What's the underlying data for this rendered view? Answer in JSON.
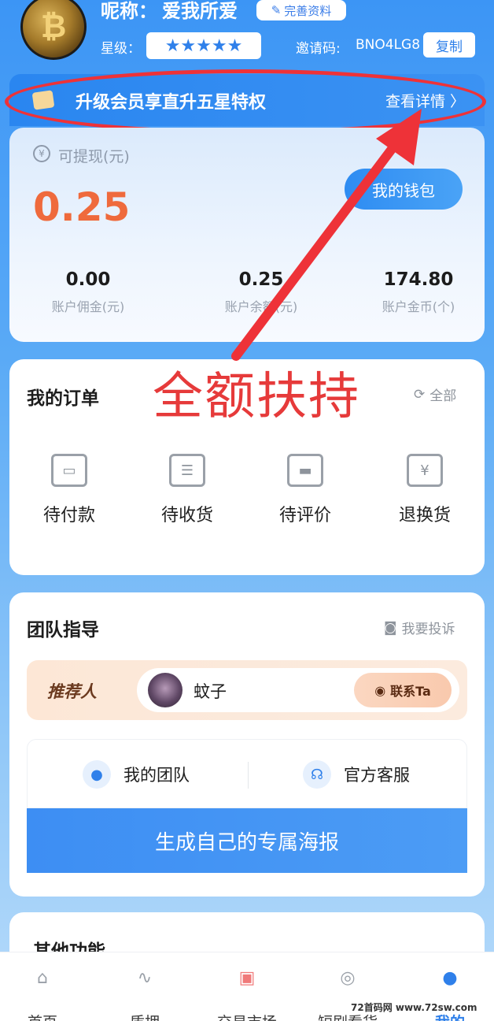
{
  "header": {
    "avatar_glyph": "₿",
    "nickname_label": "呢称：",
    "nickname": "爱我所爱",
    "edit_profile": "完善资料",
    "star_label": "星级：",
    "stars": "★★★★★",
    "invite_label": "邀请码:",
    "invite_code": "BNO4LG8",
    "copy": "复制"
  },
  "vip_banner": {
    "text": "升级会员享直升五星特权",
    "detail": "查看详情 〉"
  },
  "wallet": {
    "withdraw_label": "可提现(元)",
    "withdraw_amount": "0.25",
    "wallet_button": "我的钱包",
    "stats": [
      {
        "value": "0.00",
        "label": "账户佣金(元)"
      },
      {
        "value": "0.25",
        "label": "账户余额(元)"
      },
      {
        "value": "174.80",
        "label": "账户金币(个)"
      }
    ]
  },
  "annotation": {
    "big_text": "全额扶持"
  },
  "orders": {
    "title": "我的订单",
    "all": "全部",
    "items": [
      {
        "label": "待付款",
        "icon": "wallet-icon"
      },
      {
        "label": "待收货",
        "icon": "box-icon"
      },
      {
        "label": "待评价",
        "icon": "archive-icon"
      },
      {
        "label": "退换货",
        "icon": "refund-icon"
      }
    ]
  },
  "team": {
    "title": "团队指导",
    "complain": "我要投诉",
    "referrer_label": "推荐人",
    "referrer_name": "蚊子",
    "contact": "联系Ta",
    "my_team": "我的团队",
    "service": "官方客服",
    "poster": "生成自己的专属海报"
  },
  "other": {
    "title": "其他功能"
  },
  "nav": [
    {
      "label": "首页",
      "icon": "home-icon"
    },
    {
      "label": "质押",
      "icon": "pulse-icon"
    },
    {
      "label": "交易市场",
      "icon": "shop-icon"
    },
    {
      "label": "短剧看货",
      "icon": "play-icon"
    },
    {
      "label": "我的",
      "icon": "user-icon"
    }
  ],
  "watermark": "72首码网 www.72sw.com",
  "colors": {
    "accent": "#2f80ea",
    "amount": "#ef6a3c",
    "annotation_red": "#e63a3a"
  }
}
